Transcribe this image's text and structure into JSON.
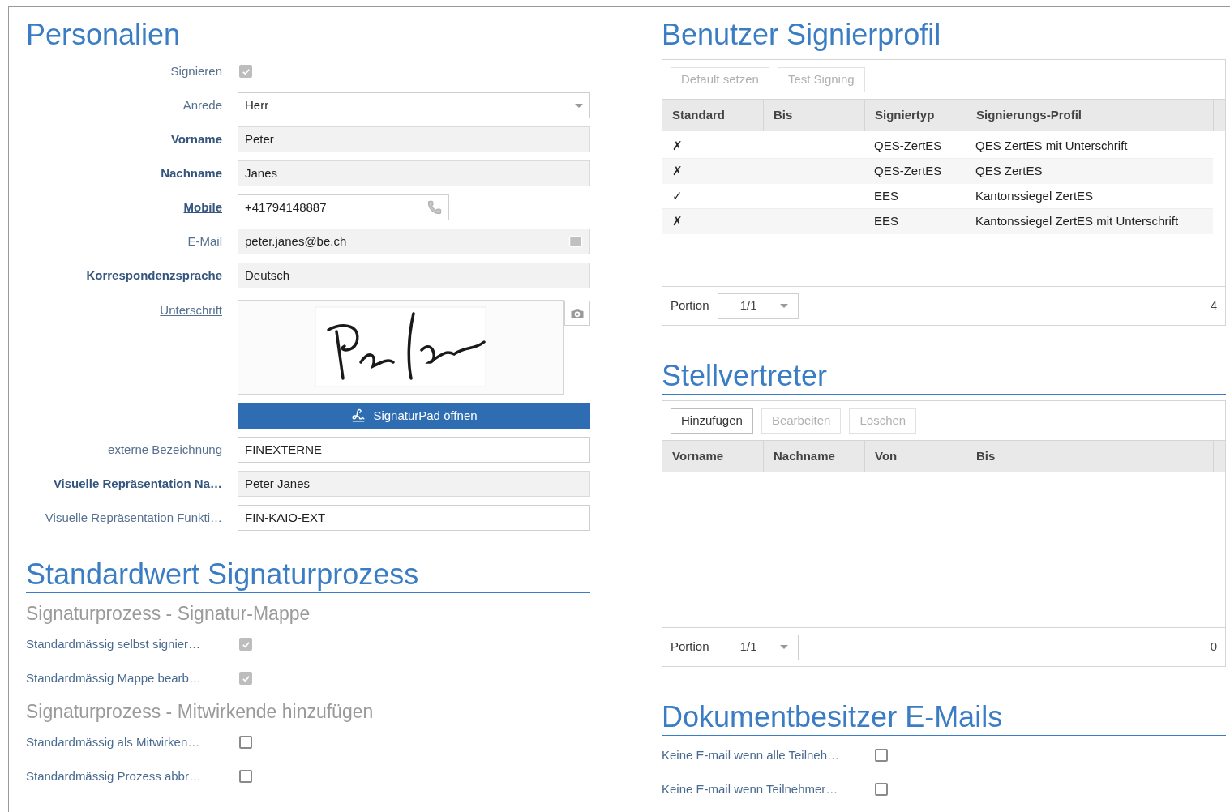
{
  "personalien": {
    "title": "Personalien",
    "fields": [
      {
        "kind": "checkbox",
        "label": "Signieren",
        "label_bold": false,
        "label_link": false,
        "checked": true,
        "disabled": true
      },
      {
        "kind": "select",
        "label": "Anrede",
        "label_bold": false,
        "label_link": false,
        "value": "Herr"
      },
      {
        "kind": "text",
        "label": "Vorname",
        "label_bold": true,
        "label_link": false,
        "value": "Peter",
        "readonly": true
      },
      {
        "kind": "text",
        "label": "Nachname",
        "label_bold": true,
        "label_link": false,
        "value": "Janes",
        "readonly": true
      },
      {
        "kind": "phone",
        "label": "Mobile",
        "label_bold": true,
        "label_link": true,
        "value": "+41794148887",
        "readonly": false
      },
      {
        "kind": "email",
        "label": "E-Mail",
        "label_bold": false,
        "label_link": false,
        "value": "peter.janes@be.ch",
        "readonly": true
      },
      {
        "kind": "text",
        "label": "Korrespondenzsprache",
        "label_bold": true,
        "label_link": false,
        "value": "Deutsch",
        "readonly": true
      },
      {
        "kind": "signature",
        "label": "Unterschrift",
        "label_bold": false,
        "label_link": true,
        "button": "SignaturPad öffnen"
      },
      {
        "kind": "text",
        "label": "externe Bezeichnung",
        "label_bold": false,
        "label_link": false,
        "value": "FINEXTERNE",
        "readonly": false
      },
      {
        "kind": "text",
        "label": "Visuelle Repräsentation Na…",
        "label_bold": true,
        "label_link": false,
        "value": "Peter Janes",
        "readonly": true
      },
      {
        "kind": "text",
        "label": "Visuelle Repräsentation Funkti…",
        "label_bold": false,
        "label_link": false,
        "value": "FIN-KAIO-EXT",
        "readonly": false
      }
    ]
  },
  "standardwert": {
    "title": "Standardwert Signaturprozess",
    "groups": [
      {
        "title": "Signaturprozess - Signatur-Mappe",
        "options": [
          {
            "label": "Standardmässig selbst signier…",
            "checked": true,
            "disabled": true
          },
          {
            "label": "Standardmässig Mappe bearb…",
            "checked": true,
            "disabled": true
          }
        ]
      },
      {
        "title": "Signaturprozess - Mitwirkende hinzufügen",
        "options": [
          {
            "label": "Standardmässig als Mitwirken…",
            "checked": false,
            "disabled": false
          },
          {
            "label": "Standardmässig Prozess abbr…",
            "checked": false,
            "disabled": false
          }
        ]
      }
    ]
  },
  "signierprofil": {
    "title": "Benutzer Signierprofil",
    "buttons": [
      {
        "label": "Default setzen",
        "disabled": true
      },
      {
        "label": "Test Signing",
        "disabled": true
      }
    ],
    "columns": [
      "Standard",
      "Bis",
      "Signiertyp",
      "Signierungs-Profil"
    ],
    "rows": [
      {
        "standard": "✗",
        "signiertyp": "QES-ZertES",
        "profil": "QES ZertES mit Unterschrift"
      },
      {
        "standard": "✗",
        "signiertyp": "QES-ZertES",
        "profil": "QES ZertES"
      },
      {
        "standard": "✓",
        "signiertyp": "EES",
        "profil": "Kantonssiegel ZertES"
      },
      {
        "standard": "✗",
        "signiertyp": "EES",
        "profil": "Kantonssiegel ZertES mit Unterschrift"
      }
    ],
    "portion_label": "Portion",
    "portion": "1/1",
    "count": "4"
  },
  "stellvertreter": {
    "title": "Stellvertreter",
    "buttons": [
      {
        "label": "Hinzufügen",
        "disabled": false
      },
      {
        "label": "Bearbeiten",
        "disabled": true
      },
      {
        "label": "Löschen",
        "disabled": true
      }
    ],
    "columns": [
      "Vorname",
      "Nachname",
      "Von",
      "Bis"
    ],
    "portion_label": "Portion",
    "portion": "1/1",
    "count": "0"
  },
  "dokumentbesitzer": {
    "title": "Dokumentbesitzer E-Mails",
    "options": [
      {
        "label": "Keine E-mail wenn alle Teilneh…",
        "checked": false,
        "disabled": false
      },
      {
        "label": "Keine E-mail wenn Teilnehmer…",
        "checked": false,
        "disabled": false
      }
    ]
  }
}
